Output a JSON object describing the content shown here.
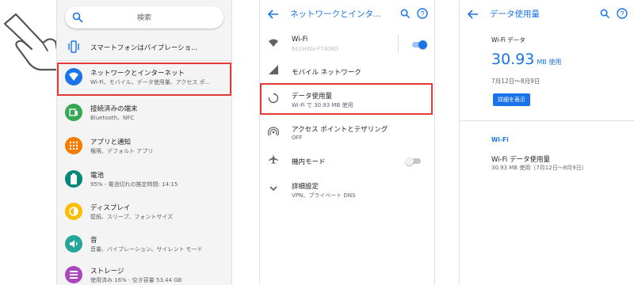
{
  "panel1": {
    "search_placeholder": "検索",
    "items": [
      {
        "icon": "vibrate-icon",
        "title": "スマートフォンはバイブレーショ..."
      },
      {
        "icon": "wifi-icon",
        "title": "ネットワークとインターネット",
        "subtitle": "Wi-Fi、モバイル、データ使用量、アクセス ポ..."
      },
      {
        "icon": "devices-icon",
        "title": "接続済みの端末",
        "subtitle": "Bluetooth、NFC"
      },
      {
        "icon": "apps-icon",
        "title": "アプリと通知",
        "subtitle": "権限、デフォルト アプリ"
      },
      {
        "icon": "battery-icon",
        "title": "電池",
        "subtitle": "95% - 電池切れの推定時間: 14:15"
      },
      {
        "icon": "display-icon",
        "title": "ディスプレイ",
        "subtitle": "壁紙、スリープ、フォントサイズ"
      },
      {
        "icon": "sound-icon",
        "title": "音",
        "subtitle": "音量、バイブレーション、サイレント モード"
      },
      {
        "icon": "storage-icon",
        "title": "ストレージ",
        "subtitle": "使用済み 16% - 空き容量 53.44 GB"
      }
    ]
  },
  "panel2": {
    "title": "ネットワークとインタ...",
    "items": [
      {
        "icon": "wifi-signal-icon",
        "title": "Wi-Fi",
        "subtitle": "601HWa-F7408D",
        "toggle": "on"
      },
      {
        "icon": "cellular-icon",
        "title": "モバイル ネットワーク"
      },
      {
        "icon": "data-usage-icon",
        "title": "データ使用量",
        "subtitle": "Wi-Fi で 30.93 MB 使用"
      },
      {
        "icon": "hotspot-icon",
        "title": "アクセス ポイントとテザリング",
        "subtitle": "OFF"
      },
      {
        "icon": "airplane-icon",
        "title": "機内モード",
        "toggle": "off"
      },
      {
        "icon": "chevron-down-icon",
        "title": "詳細設定",
        "subtitle": "VPN、プライベート DNS"
      }
    ]
  },
  "panel3": {
    "title": "データ使用量",
    "wifi_data_label": "Wi-Fi データ",
    "usage_value": "30.93",
    "usage_unit": "MB 使用",
    "date_range": "7月12日～8月9日",
    "detail_button": "詳細を表示",
    "section_header": "Wi-Fi",
    "wifi_usage_title": "Wi-Fi データ使用量",
    "wifi_usage_subtitle": "30.93 MB 使用（7月12日～8月9日）"
  },
  "colors": {
    "accent": "#1a73e8",
    "highlight": "#e53935",
    "toggle_on": "#1a73e8"
  }
}
